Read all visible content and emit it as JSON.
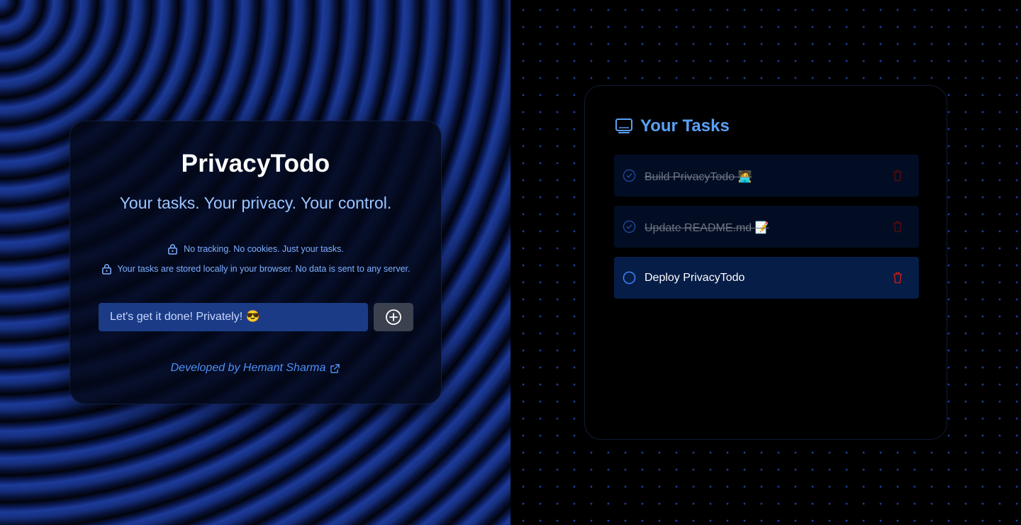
{
  "app": {
    "title": "PrivacyTodo",
    "tagline": "Your tasks. Your privacy. Your control."
  },
  "privacy": {
    "line1": "No tracking. No cookies. Just your tasks.",
    "line2": "Your tasks are stored locally in your browser. No data is sent to any server."
  },
  "input": {
    "placeholder": "Let's get it done! Privately! 😎",
    "value": ""
  },
  "add_button": {
    "icon": "plus-circle-icon"
  },
  "footer": {
    "credit": "Developed by Hemant Sharma",
    "icon": "external-link-icon"
  },
  "tasks": {
    "title": "Your Tasks",
    "icon": "monitor-icon",
    "items": [
      {
        "text": "Build PrivacyTodo 🧑‍💻",
        "completed": true
      },
      {
        "text": "Update README.md 📝",
        "completed": true
      },
      {
        "text": "Deploy PrivacyTodo",
        "completed": false
      }
    ]
  },
  "colors": {
    "accent": "#5aa0f5",
    "link": "#4f8ff5",
    "danger": "#b91c1c",
    "input_bg": "#1b3b86"
  }
}
